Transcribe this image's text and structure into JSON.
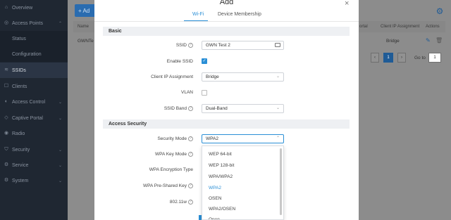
{
  "sidebar": {
    "items": [
      {
        "label": "Overview",
        "icon": "home-icon",
        "glyph": "⌂",
        "chevron": ""
      },
      {
        "label": "Access Points",
        "icon": "access-point-icon",
        "glyph": "◎",
        "chevron": "⌃"
      },
      {
        "label": "Status",
        "icon": "",
        "glyph": "",
        "chevron": ""
      },
      {
        "label": "Configuration",
        "icon": "",
        "glyph": "",
        "chevron": ""
      },
      {
        "label": "SSIDs",
        "icon": "wifi-icon",
        "glyph": "≋",
        "chevron": ""
      },
      {
        "label": "Clients",
        "icon": "clients-icon",
        "glyph": "☐",
        "chevron": ""
      },
      {
        "label": "Access Control",
        "icon": "lock-icon",
        "glyph": "◐",
        "chevron": "⌄"
      },
      {
        "label": "Captive Portal",
        "icon": "portal-icon",
        "glyph": "◇",
        "chevron": "⌄"
      },
      {
        "label": "Radio",
        "icon": "radio-icon",
        "glyph": "◉",
        "chevron": ""
      },
      {
        "label": "Security",
        "icon": "shield-icon",
        "glyph": "⛉",
        "chevron": "⌄"
      },
      {
        "label": "Service",
        "icon": "service-icon",
        "glyph": "⚙",
        "chevron": "⌄"
      },
      {
        "label": "System",
        "icon": "system-icon",
        "glyph": "⚙",
        "chevron": "⌄"
      }
    ]
  },
  "background": {
    "add_button": "+ Ad",
    "table_headers": [
      "Name",
      "ortal",
      "Client IP Assignment",
      "Actions"
    ],
    "row": {
      "name": "GWNTe",
      "assignment": "Bridge"
    },
    "pager": {
      "page": "1",
      "goto_label": "Go to",
      "goto_value": "1"
    }
  },
  "modal": {
    "title": "Add",
    "close_glyph": "×",
    "tabs": [
      "Wi-Fi",
      "Device Membership"
    ],
    "sections": {
      "basic": "Basic",
      "access_security": "Access Security"
    },
    "fields": {
      "ssid_label": "SSID",
      "ssid_value": "GWN Test 2",
      "enable_ssid_label": "Enable SSID",
      "client_ip_label": "Client IP Assignment",
      "client_ip_value": "Bridge",
      "vlan_label": "VLAN",
      "ssid_band_label": "SSID Band",
      "ssid_band_value": "Dual-Band",
      "security_mode_label": "Security Mode",
      "security_mode_value": "WPA2",
      "wpa_key_mode_label": "WPA Key Mode",
      "wpa_encryption_label": "WPA Encryption Type",
      "wpa_psk_label": "WPA Pre-Shared Key",
      "dot11w_label": "802.11w"
    },
    "security_mode_options": [
      "WEP 64-bit",
      "WEP 128-bit",
      "WPA/WPA2",
      "WPA2",
      "OSEN",
      "WPA2/OSEN",
      "Open"
    ],
    "selected_option": "WPA2",
    "colors": {
      "accent": "#2a8fd6",
      "sidebar_bg": "#1f2732"
    }
  }
}
